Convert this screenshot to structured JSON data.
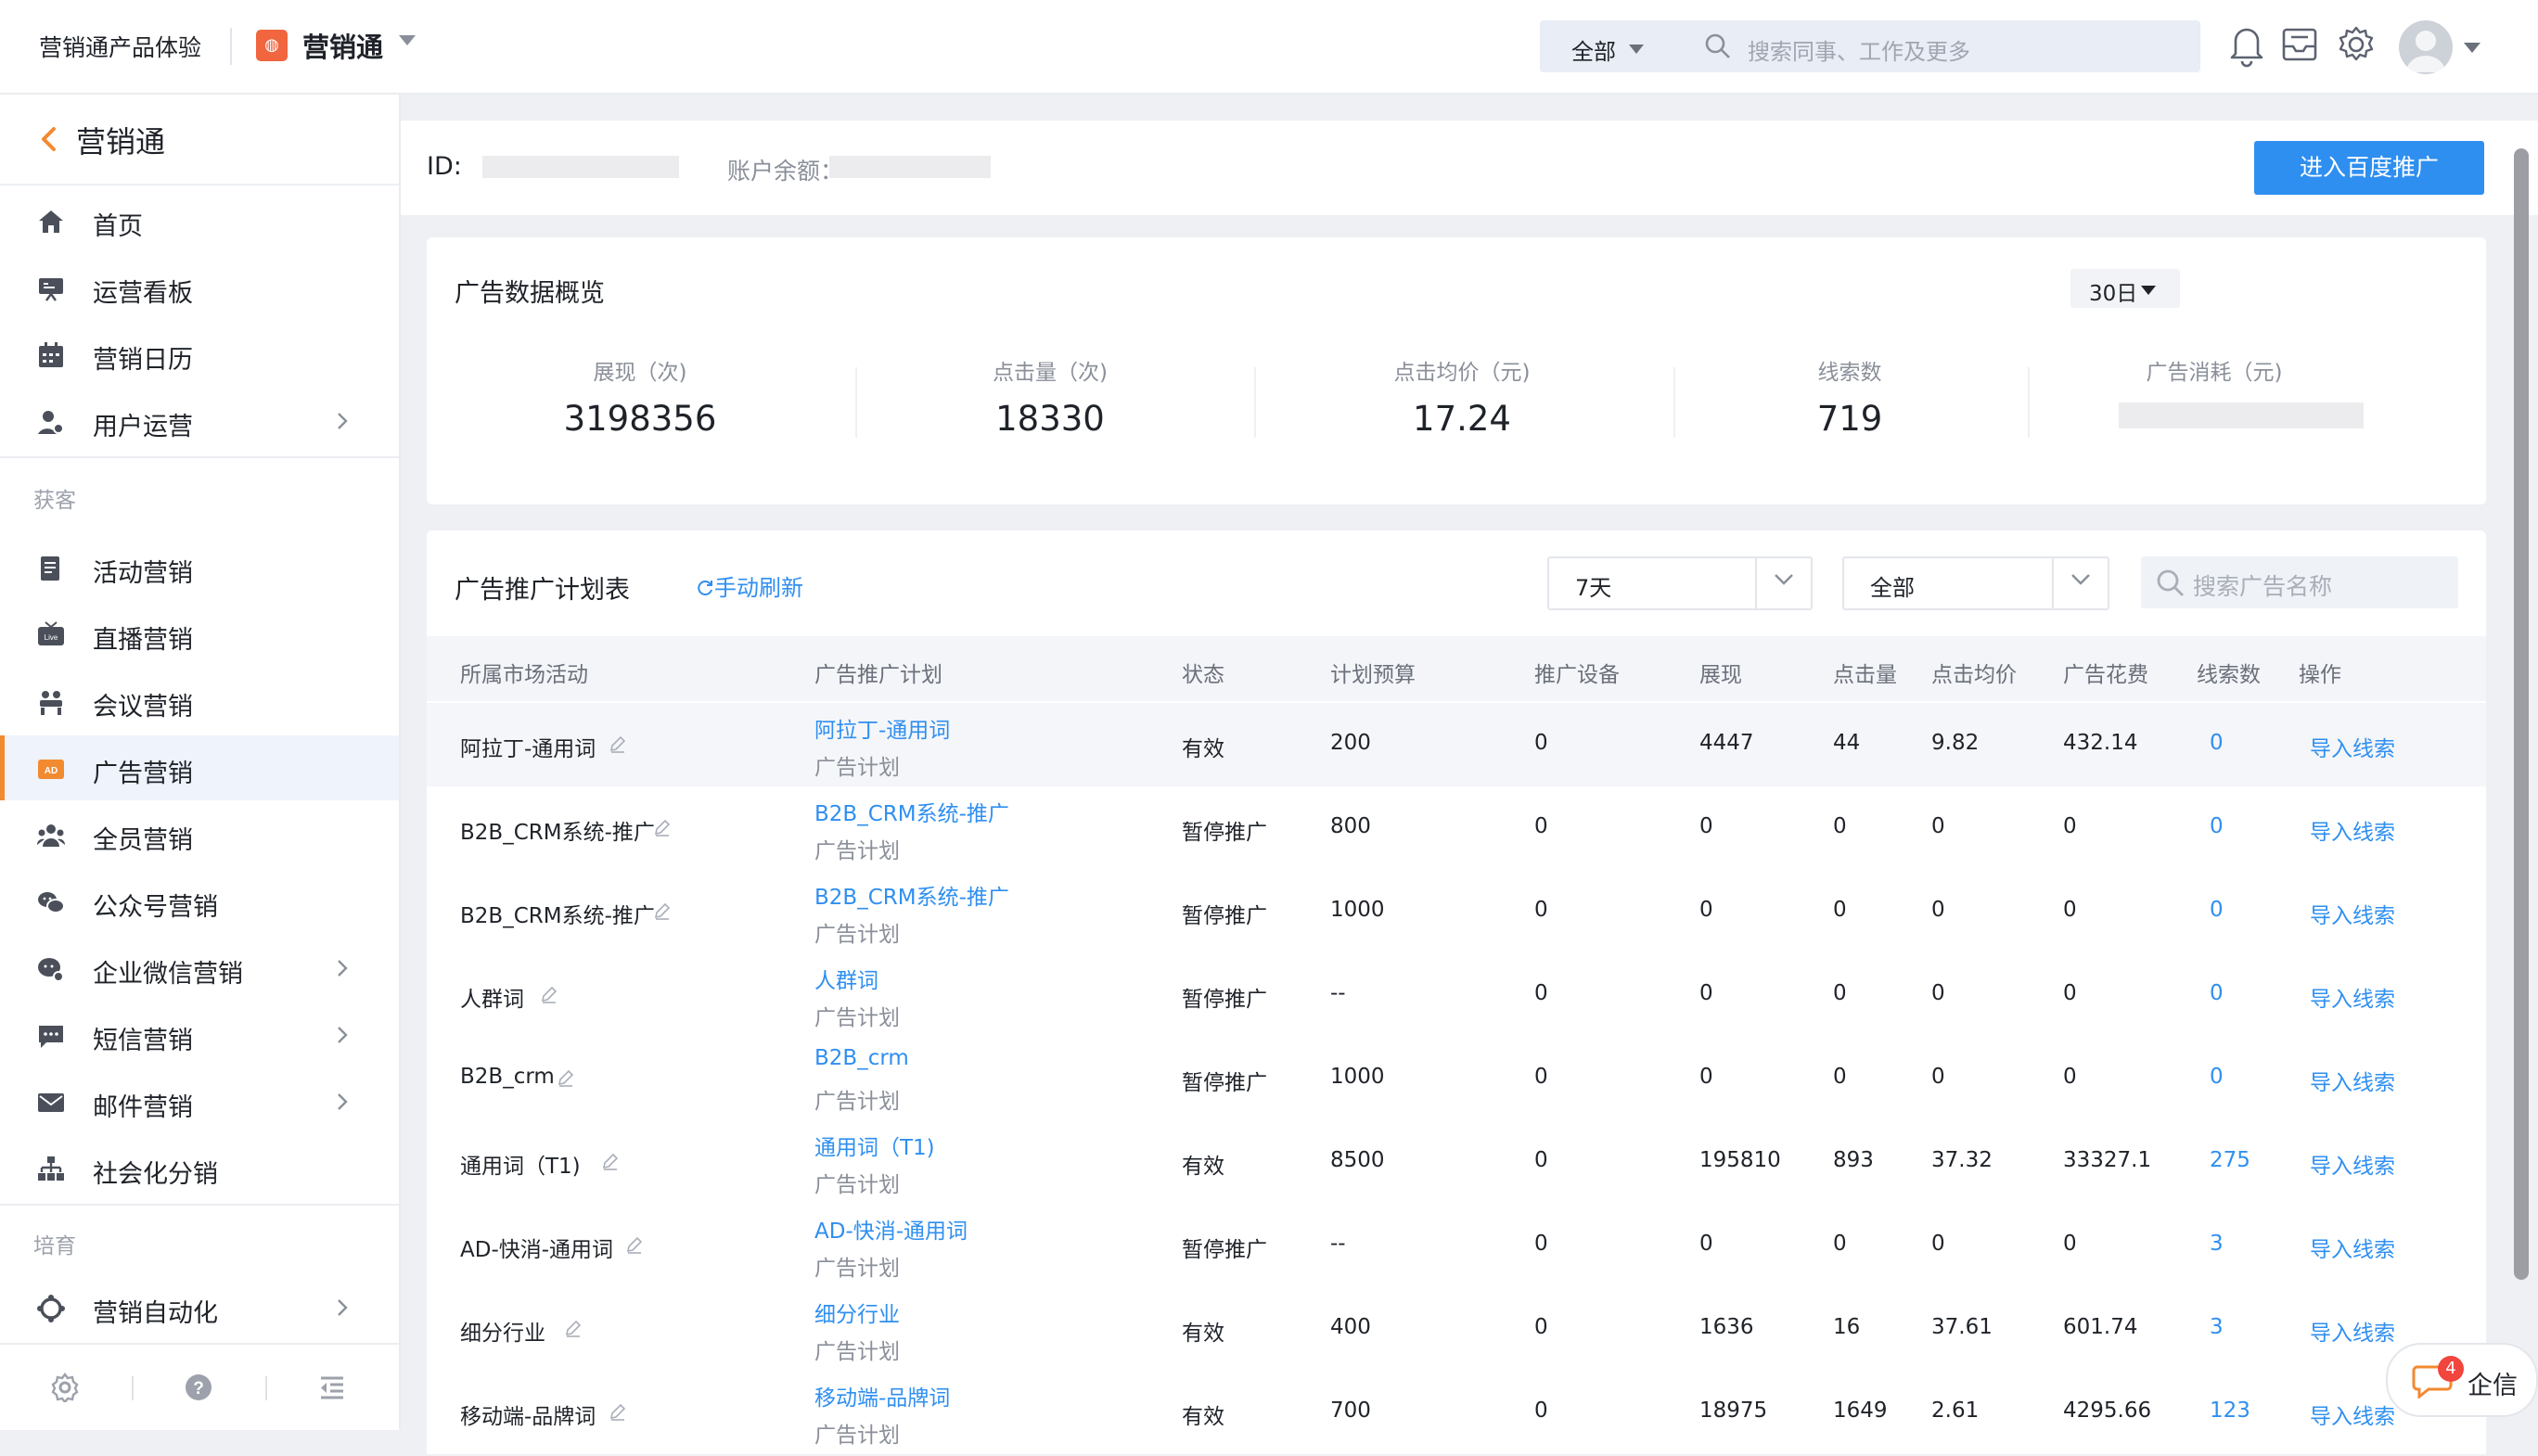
{
  "header": {
    "product_title": "营销通产品体验",
    "app_logo_glyph": "◍",
    "app_name": "营销通",
    "scope": "全部",
    "search_placeholder": "搜索同事、工作及更多",
    "icons": [
      "bell-icon",
      "inbox-icon",
      "gear-icon",
      "avatar"
    ]
  },
  "sidebar": {
    "back_label": "营销通",
    "items_main": [
      {
        "label": "首页",
        "icon": "home-icon"
      },
      {
        "label": "运营看板",
        "icon": "dashboard-icon"
      },
      {
        "label": "营销日历",
        "icon": "calendar-icon"
      },
      {
        "label": "用户运营",
        "icon": "user-icon",
        "has_arrow": true
      }
    ],
    "section_acquire": "获客",
    "items_acquire": [
      {
        "label": "活动营销",
        "icon": "doc-icon"
      },
      {
        "label": "直播营销",
        "icon": "live-icon"
      },
      {
        "label": "会议营销",
        "icon": "meeting-icon"
      },
      {
        "label": "广告营销",
        "icon": "ad-icon",
        "active": true
      },
      {
        "label": "全员营销",
        "icon": "team-icon"
      },
      {
        "label": "公众号营销",
        "icon": "wechat-icon"
      },
      {
        "label": "企业微信营销",
        "icon": "wecom-icon",
        "has_arrow": true
      },
      {
        "label": "短信营销",
        "icon": "sms-icon",
        "has_arrow": true
      },
      {
        "label": "邮件营销",
        "icon": "mail-icon",
        "has_arrow": true
      },
      {
        "label": "社会化分销",
        "icon": "org-icon"
      }
    ],
    "section_nurture": "培育",
    "items_nurture": [
      {
        "label": "营销自动化",
        "icon": "automation-icon",
        "has_arrow": true
      }
    ],
    "accent_color": "#f28a30"
  },
  "account": {
    "id_label": "ID:",
    "balance_label": "账户余额：",
    "enter_button": "进入百度推广"
  },
  "overview": {
    "title": "广告数据概览",
    "range": "30日",
    "metrics": [
      {
        "label": "展现（次)",
        "value": "3198356"
      },
      {
        "label": "点击量（次)",
        "value": "18330"
      },
      {
        "label": "点击均价（元)",
        "value": "17.24"
      },
      {
        "label": "线索数",
        "value": "719"
      },
      {
        "label": "广告消耗（元)",
        "value": ""
      }
    ]
  },
  "plans": {
    "title": "广告推广计划表",
    "refresh": "手动刷新",
    "filter_days": "7天",
    "filter_status": "全部",
    "search_placeholder": "搜索广告名称",
    "columns": [
      "所属市场活动",
      "广告推广计划",
      "状态",
      "计划预算",
      "推广设备",
      "展现",
      "点击量",
      "点击均价",
      "广告花费",
      "线索数",
      "操作"
    ],
    "sub_label": "广告计划",
    "action_label": "导入线索",
    "rows": [
      {
        "activity": "阿拉丁-通用词",
        "plan": "阿拉丁-通用词",
        "status": "有效",
        "budget": "200",
        "device": "0",
        "impressions": "4447",
        "clicks": "44",
        "cpc": "9.82",
        "cost": "432.14",
        "leads": "0"
      },
      {
        "activity": "B2B_CRM系统-推广",
        "plan": "B2B_CRM系统-推广",
        "status": "暂停推广",
        "budget": "800",
        "device": "0",
        "impressions": "0",
        "clicks": "0",
        "cpc": "0",
        "cost": "0",
        "leads": "0"
      },
      {
        "activity": "B2B_CRM系统-推广",
        "plan": "B2B_CRM系统-推广",
        "status": "暂停推广",
        "budget": "1000",
        "device": "0",
        "impressions": "0",
        "clicks": "0",
        "cpc": "0",
        "cost": "0",
        "leads": "0"
      },
      {
        "activity": "人群词",
        "plan": "人群词",
        "status": "暂停推广",
        "budget": "--",
        "device": "0",
        "impressions": "0",
        "clicks": "0",
        "cpc": "0",
        "cost": "0",
        "leads": "0"
      },
      {
        "activity": "B2B_crm",
        "plan": "B2B_crm",
        "status": "暂停推广",
        "budget": "1000",
        "device": "0",
        "impressions": "0",
        "clicks": "0",
        "cpc": "0",
        "cost": "0",
        "leads": "0"
      },
      {
        "activity": "通用词（T1)",
        "plan": "通用词（T1)",
        "status": "有效",
        "budget": "8500",
        "device": "0",
        "impressions": "195810",
        "clicks": "893",
        "cpc": "37.32",
        "cost": "33327.1",
        "leads": "275"
      },
      {
        "activity": "AD-快消-通用词",
        "plan": "AD-快消-通用词",
        "status": "暂停推广",
        "budget": "--",
        "device": "0",
        "impressions": "0",
        "clicks": "0",
        "cpc": "0",
        "cost": "0",
        "leads": "3"
      },
      {
        "activity": "细分行业",
        "plan": "细分行业",
        "status": "有效",
        "budget": "400",
        "device": "0",
        "impressions": "1636",
        "clicks": "16",
        "cpc": "37.61",
        "cost": "601.74",
        "leads": "3"
      },
      {
        "activity": "移动端-品牌词",
        "plan": "移动端-品牌词",
        "status": "有效",
        "budget": "700",
        "device": "0",
        "impressions": "18975",
        "clicks": "1649",
        "cpc": "2.61",
        "cost": "4295.66",
        "leads": "123"
      }
    ]
  },
  "qixin": {
    "label": "企信",
    "badge": "4"
  }
}
